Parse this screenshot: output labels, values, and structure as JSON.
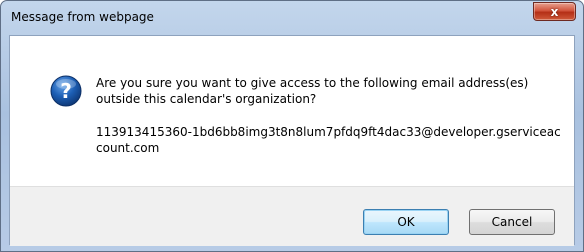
{
  "window": {
    "title": "Message from webpage",
    "close_glyph": "x"
  },
  "dialog": {
    "icon": "question-icon",
    "message": "Are you sure you want to give access to the following email address(es) outside this calendar's organization?",
    "email": "113913415360-1bd6bb8img3t8n8lum7pfdq9ft4dac33@developer.gserviceaccount.com"
  },
  "buttons": {
    "ok_label": "OK",
    "cancel_label": "Cancel"
  },
  "colors": {
    "icon_blue": "#1d5fb5",
    "ok_border": "#3c7fb1",
    "close_red": "#c4412b"
  }
}
